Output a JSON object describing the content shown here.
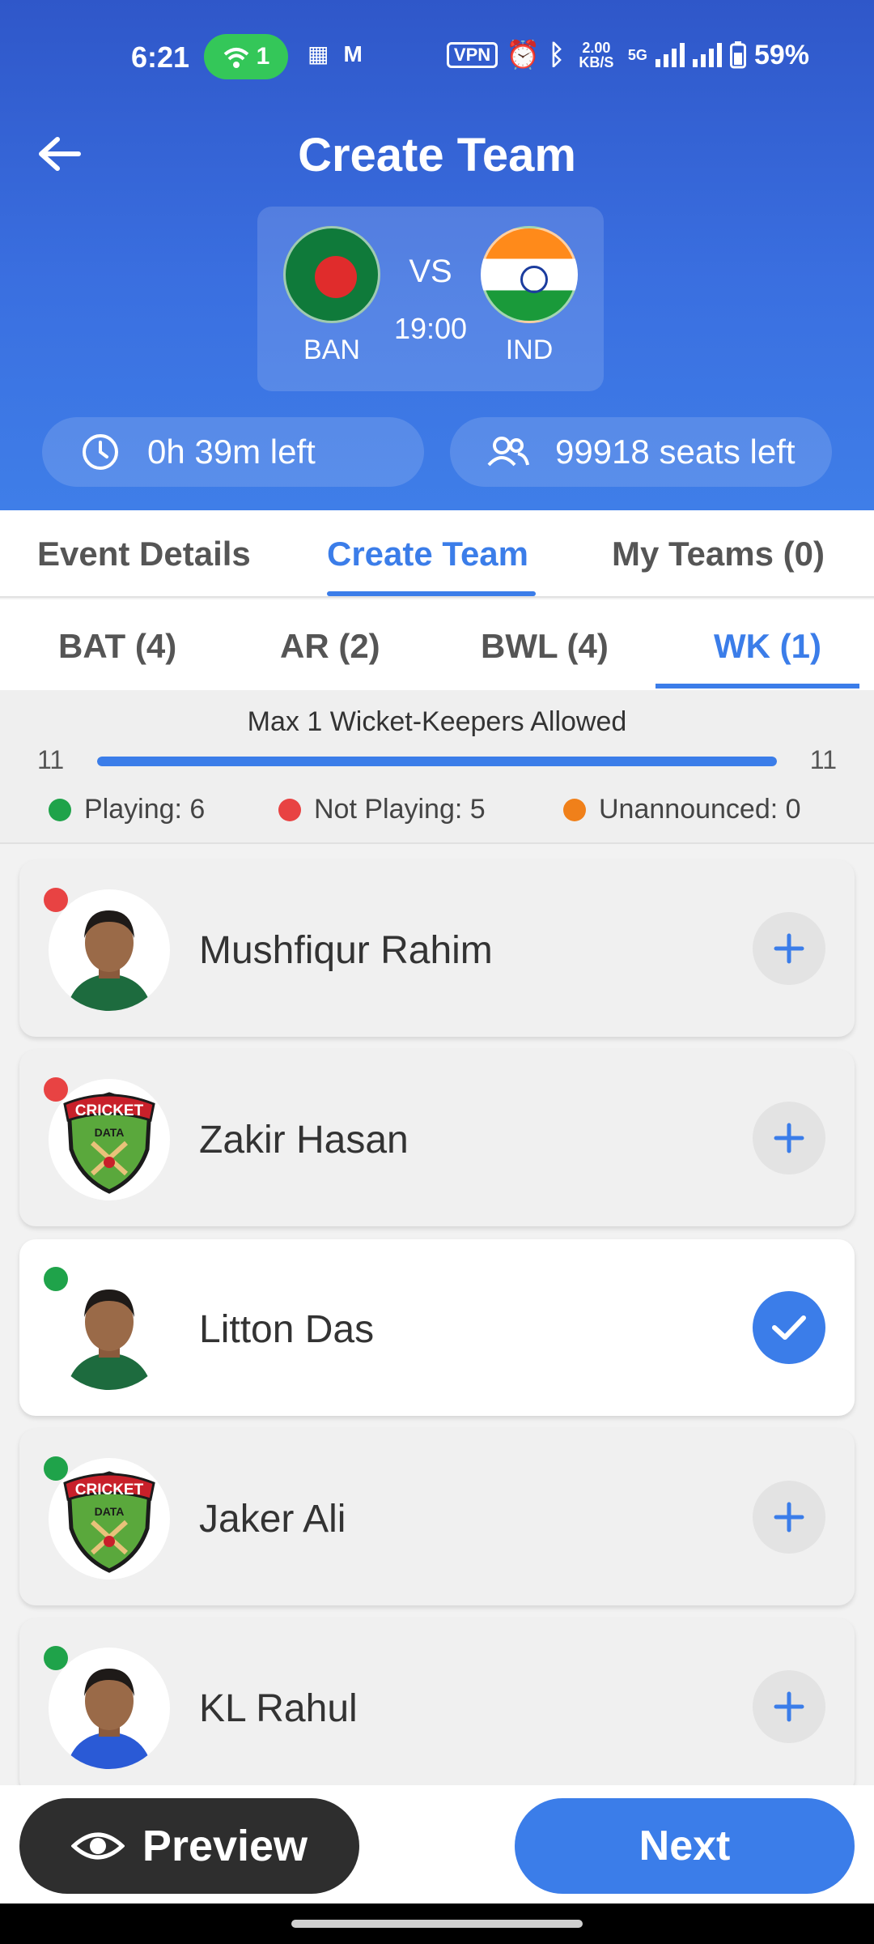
{
  "status_bar": {
    "time": "6:21",
    "hotspot_count": "1",
    "vpn": "VPN",
    "speed": "2.00 KB/S",
    "network": "5G",
    "battery": "59%"
  },
  "header": {
    "title": "Create Team",
    "match": {
      "team1": "BAN",
      "team2": "IND",
      "vs": "VS",
      "time": "19:00"
    },
    "time_left": "0h 39m left",
    "seats_left": "99918 seats left"
  },
  "main_tabs": [
    {
      "label": "Event Details",
      "active": false
    },
    {
      "label": "Create Team",
      "active": true
    },
    {
      "label": "My Teams (0)",
      "active": false
    }
  ],
  "role_tabs": [
    {
      "label": "BAT (4)",
      "active": false
    },
    {
      "label": "AR (2)",
      "active": false
    },
    {
      "label": "BWL (4)",
      "active": false
    },
    {
      "label": "WK (1)",
      "active": true
    }
  ],
  "selection_info": {
    "title": "Max 1 Wicket-Keepers Allowed",
    "progress_min": "11",
    "progress_max": "11",
    "progress_fraction": 1.0,
    "legend": [
      {
        "label": "Playing: 6",
        "color": "#1fa34a"
      },
      {
        "label": "Not Playing: 5",
        "color": "#e84343"
      },
      {
        "label": "Unannounced: 0",
        "color": "#f0801a"
      }
    ]
  },
  "players": [
    {
      "name": "Mushfiqur Rahim",
      "status_color": "#e84343",
      "avatar": "player-photo",
      "selected": false
    },
    {
      "name": "Zakir Hasan",
      "status_color": "#e84343",
      "avatar": "cricket-data-logo",
      "selected": false
    },
    {
      "name": "Litton Das",
      "status_color": "#1fa34a",
      "avatar": "player-photo",
      "selected": true
    },
    {
      "name": "Jaker Ali",
      "status_color": "#1fa34a",
      "avatar": "cricket-data-logo",
      "selected": false
    },
    {
      "name": "KL Rahul",
      "status_color": "#1fa34a",
      "avatar": "player-photo",
      "selected": false
    }
  ],
  "logo_text": {
    "line1": "CRICKET",
    "line2": "DATA"
  },
  "bottom_bar": {
    "preview_label": "Preview",
    "next_label": "Next"
  },
  "colors": {
    "accent": "#3b7de9",
    "header_gradient_top": "#2f57c9",
    "header_gradient_bottom": "#3f7ee8"
  }
}
